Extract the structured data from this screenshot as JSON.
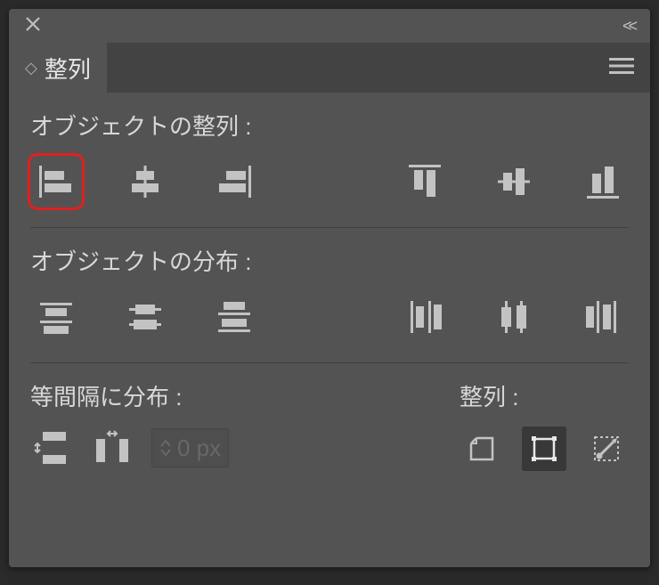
{
  "titlebar": {
    "close": "×",
    "collapse": "<<"
  },
  "tab": {
    "name": "整列"
  },
  "sections": {
    "align_objects": "オブジェクトの整列 :",
    "distribute_objects": "オブジェクトの分布 :",
    "distribute_spacing": "等間隔に分布 :",
    "align_to": "整列 :"
  },
  "spacing": {
    "value": "0 px"
  },
  "colors": {
    "panel_bg": "#535353",
    "tabbar_bg": "#434343",
    "text": "#d8d8d8",
    "icon": "#c3c3c3",
    "highlight": "#e02020"
  }
}
